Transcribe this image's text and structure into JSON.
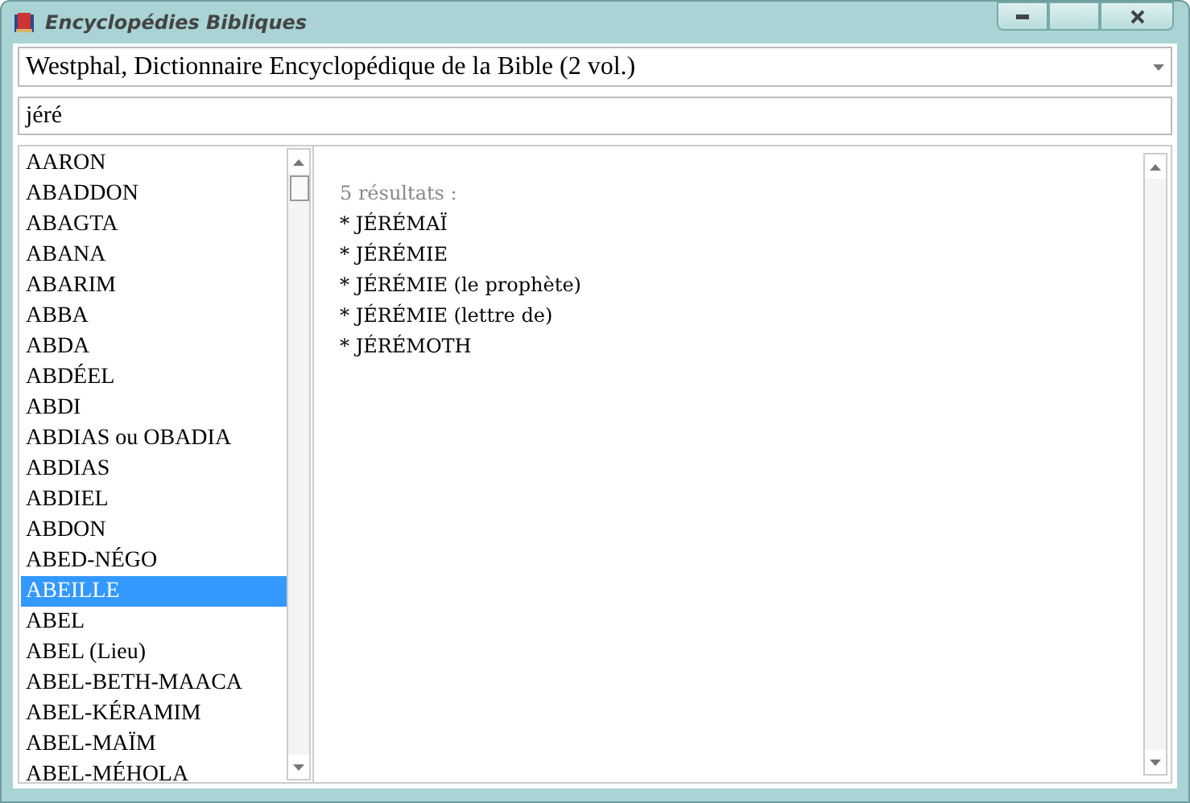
{
  "window": {
    "title": "Encyclopédies Bibliques"
  },
  "source": {
    "value": "Westphal, Dictionnaire Encyclopédique de la Bible (2 vol.)"
  },
  "search": {
    "value": "jéré"
  },
  "entries": [
    {
      "label": "AARON",
      "selected": false
    },
    {
      "label": "ABADDON",
      "selected": false
    },
    {
      "label": "ABAGTA",
      "selected": false
    },
    {
      "label": "ABANA",
      "selected": false
    },
    {
      "label": "ABARIM",
      "selected": false
    },
    {
      "label": "ABBA",
      "selected": false
    },
    {
      "label": "ABDA",
      "selected": false
    },
    {
      "label": "ABDÉEL",
      "selected": false
    },
    {
      "label": "ABDI",
      "selected": false
    },
    {
      "label": "ABDIAS ou OBADIA",
      "selected": false
    },
    {
      "label": "ABDIAS",
      "selected": false
    },
    {
      "label": "ABDIEL",
      "selected": false
    },
    {
      "label": "ABDON",
      "selected": false
    },
    {
      "label": "ABED-NÉGO",
      "selected": false
    },
    {
      "label": "ABEILLE",
      "selected": true
    },
    {
      "label": "ABEL",
      "selected": false
    },
    {
      "label": "ABEL (Lieu)",
      "selected": false
    },
    {
      "label": "ABEL-BETH-MAACA",
      "selected": false
    },
    {
      "label": "ABEL-KÉRAMIM",
      "selected": false
    },
    {
      "label": "ABEL-MAÏM",
      "selected": false
    },
    {
      "label": "ABEL-MÉHOLA",
      "selected": false
    }
  ],
  "results": {
    "count": "5 résultats :",
    "items": [
      "* JÉRÉMAÏ",
      "* JÉRÉMIE",
      "* JÉRÉMIE (le prophète)",
      "* JÉRÉMIE (lettre de)",
      "* JÉRÉMOTH"
    ]
  }
}
